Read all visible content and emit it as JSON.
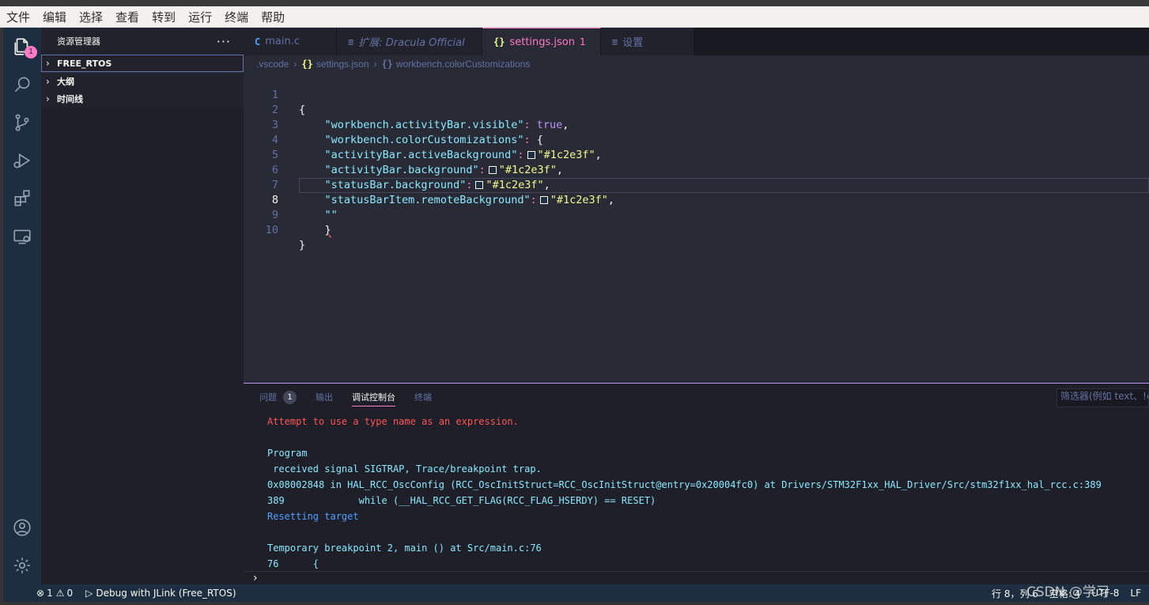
{
  "menubar": [
    "文件",
    "编辑",
    "选择",
    "查看",
    "转到",
    "运行",
    "终端",
    "帮助"
  ],
  "activity": {
    "explorer_badge": "1"
  },
  "sidebar": {
    "title": "资源管理器",
    "more": "···",
    "sections": [
      {
        "label": "FREE_RTOS"
      },
      {
        "label": "大纲"
      },
      {
        "label": "时间线"
      }
    ]
  },
  "tabs": [
    {
      "icon": "C",
      "label": "main.c"
    },
    {
      "icon": "≡",
      "label": "扩展: Dracula Official"
    },
    {
      "icon": "{}",
      "label": "settings.json",
      "count": "1"
    },
    {
      "icon": "≡",
      "label": "设置"
    }
  ],
  "breadcrumb": {
    "folder": ".vscode",
    "file_icon": "{}",
    "file": "settings.json",
    "key_icon": "{}",
    "key": "workbench.colorCustomizations"
  },
  "editor": {
    "line_numbers": [
      "1",
      "2",
      "3",
      "4",
      "5",
      "6",
      "7",
      "8",
      "9",
      "10"
    ],
    "brace_open": "{",
    "l2_key": "\"workbench.activityBar.visible\"",
    "l2_val": "true",
    "l3_key": "\"workbench.colorCustomizations\"",
    "l4_key": "\"activityBar.activeBackground\"",
    "l5_key": "\"activityBar.background\"",
    "l6_key": "\"statusBar.background\"",
    "l7_key": "\"statusBarItem.remoteBackground\"",
    "color_value": "\"#1c2e3f\"",
    "l8_text": "\"\"",
    "l9_text": "}",
    "brace_close": "}"
  },
  "panel": {
    "tabs": {
      "problems": "问题",
      "problems_count": "1",
      "output": "输出",
      "debug_console": "调试控制台",
      "terminal": "终端"
    },
    "filter_placeholder": "筛选器(例如 text、!e",
    "console": [
      {
        "text": "Attempt to use a type name as an expression.",
        "kind": "err"
      },
      {
        "text": "",
        "kind": ""
      },
      {
        "text": "Program",
        "kind": ""
      },
      {
        "text": " received signal SIGTRAP, Trace/breakpoint trap.",
        "kind": ""
      },
      {
        "text": "0x08002848 in HAL_RCC_OscConfig (RCC_OscInitStruct=RCC_OscInitStruct@entry=0x20004fc0) at Drivers/STM32F1xx_HAL_Driver/Src/stm32f1xx_hal_rcc.c:389",
        "kind": ""
      },
      {
        "text": "389             while (__HAL_RCC_GET_FLAG(RCC_FLAG_HSERDY) == RESET)",
        "kind": ""
      },
      {
        "text": "Resetting target",
        "kind": "info"
      },
      {
        "text": "",
        "kind": ""
      },
      {
        "text": "Temporary breakpoint 2, main () at Src/main.c:76",
        "kind": ""
      },
      {
        "text": "76      {",
        "kind": ""
      }
    ],
    "prompt": "›"
  },
  "status": {
    "errors": "1",
    "warnings": "0",
    "debug": "Debug with JLink (Free_RTOS)",
    "position": "行 8，列 6",
    "spaces": "空格: 4",
    "encoding": "UTF-8",
    "eol": "LF"
  },
  "watermark": "CSDN @学习 ",
  "colors": {
    "activity_bar": "#1c2e3f",
    "status_bar": "#1c2e3f",
    "editor_bg": "#282a36",
    "accent_pink": "#ff79c6"
  }
}
